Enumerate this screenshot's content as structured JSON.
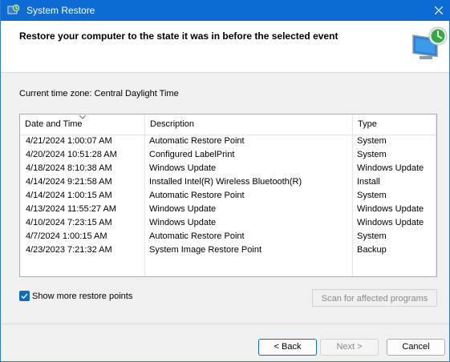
{
  "window": {
    "title": "System Restore",
    "icon": "system-restore-icon",
    "accent_color": "#0d6bd4"
  },
  "header": {
    "title": "Restore your computer to the state it was in before the selected event",
    "icon": "system-restore-monitor-icon"
  },
  "timezone_label": "Current time zone: Central Daylight Time",
  "table": {
    "columns": [
      "Date and Time",
      "Description",
      "Type"
    ],
    "rows": [
      {
        "date": "4/21/2024 1:00:07 AM",
        "description": "Automatic Restore Point",
        "type": "System"
      },
      {
        "date": "4/20/2024 10:51:28 AM",
        "description": "Configured LabelPrint",
        "type": "System"
      },
      {
        "date": "4/18/2024 8:10:38 AM",
        "description": "Windows Update",
        "type": "Windows Update"
      },
      {
        "date": "4/14/2024 9:21:58 AM",
        "description": "Installed Intel(R) Wireless Bluetooth(R)",
        "type": "Install"
      },
      {
        "date": "4/14/2024 1:00:15 AM",
        "description": "Automatic Restore Point",
        "type": "System"
      },
      {
        "date": "4/13/2024 11:55:27 AM",
        "description": "Windows Update",
        "type": "Windows Update"
      },
      {
        "date": "4/10/2024 7:23:15 AM",
        "description": "Windows Update",
        "type": "Windows Update"
      },
      {
        "date": "4/7/2024 1:00:15 AM",
        "description": "Automatic Restore Point",
        "type": "System"
      },
      {
        "date": "4/23/2023 7:21:32 AM",
        "description": "System Image Restore Point",
        "type": "Backup"
      }
    ]
  },
  "show_more": {
    "label": "Show more restore points",
    "checked": true
  },
  "scan_button": "Scan for affected programs",
  "buttons": {
    "back": "< Back",
    "next": "Next >",
    "cancel": "Cancel"
  }
}
